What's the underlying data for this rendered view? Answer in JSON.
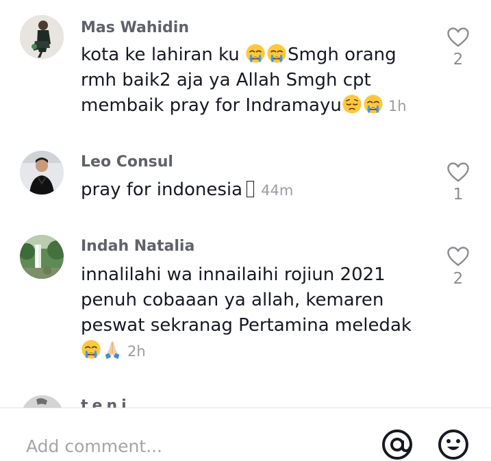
{
  "comments": [
    {
      "username": "Mas Wahidin",
      "text_1": "kota ke lahiran ku ",
      "emoji_1": [
        "crying-face",
        "crying-face"
      ],
      "text_2": "Smgh orang rmh baik2 aja ya Allah Smgh cpt membaik pray for Indramayu",
      "emoji_2": [
        "pensive-face",
        "crying-face"
      ],
      "time": "1h",
      "likes": "2"
    },
    {
      "username": "Leo Consul",
      "text_1": "pray for indonesia",
      "time": "44m",
      "likes": "1"
    },
    {
      "username": "Indah Natalia",
      "text_1": "innalilahi wa innailaihi rojiun 2021 penuh cobaaan ya allah, kemaren peswat sekranag Pertamina meledak",
      "emoji_2": [
        "crying-face",
        "folded-hands"
      ],
      "time": "2h",
      "likes": "2"
    }
  ],
  "partial_comment": {
    "username": "teni"
  },
  "footer": {
    "placeholder": "Add comment...",
    "mention_icon": "at-sign-icon",
    "emoji_icon": "emoji-icon"
  },
  "colors": {
    "username": "#60616a",
    "text": "#161823",
    "time": "#9b9ca3",
    "like": "#8a8b91"
  }
}
